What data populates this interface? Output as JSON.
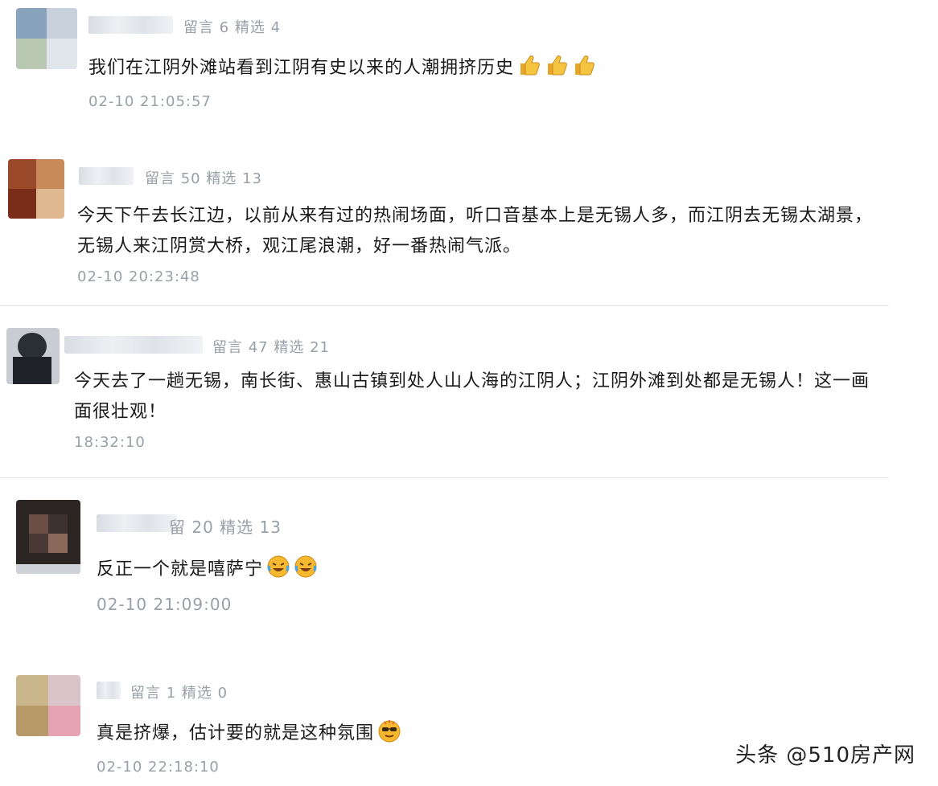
{
  "comments": [
    {
      "stats": "留言 6 精选 4",
      "text": "我们在江阴外滩站看到江阴有史以来的人潮拥挤历史",
      "emoji": "thumbs-up",
      "time": "02-10 21:05:57"
    },
    {
      "stats": "留言 50 精选 13",
      "text_lines": [
        "今天下午去长江边，以前从来有过的热闹场面，听口音基本上是无锡人多，而江阴去无锡太湖景，",
        "无锡人来江阴赏大桥，观江尾浪潮，好一番热闹气派。"
      ],
      "time": "02-10 20:23:48"
    },
    {
      "stats": "留言 47 精选 21",
      "text_lines": [
        "今天去了一趟无锡，南长街、惠山古镇到处人山人海的江阴人；江阴外滩到处都是无锡人！这一画",
        "面很壮观！"
      ],
      "time": "18:32:10"
    },
    {
      "stats": "留 20 精选 13",
      "text": "反正一个就是嘻萨宁",
      "emoji": "laugh-cry",
      "time": "02-10 21:09:00"
    },
    {
      "stats": "留言 1 精选 0",
      "text": "真是挤爆，估计要的就是这种氛围",
      "emoji": "cool-face",
      "time": "02-10 22:18:10"
    }
  ],
  "watermark": "头条 @510房产网",
  "colors": {
    "meta": "#9aa0a8",
    "text": "#1a1a1a",
    "divider": "#e3e6ea",
    "emoji_yellow": "#f5b82e"
  }
}
